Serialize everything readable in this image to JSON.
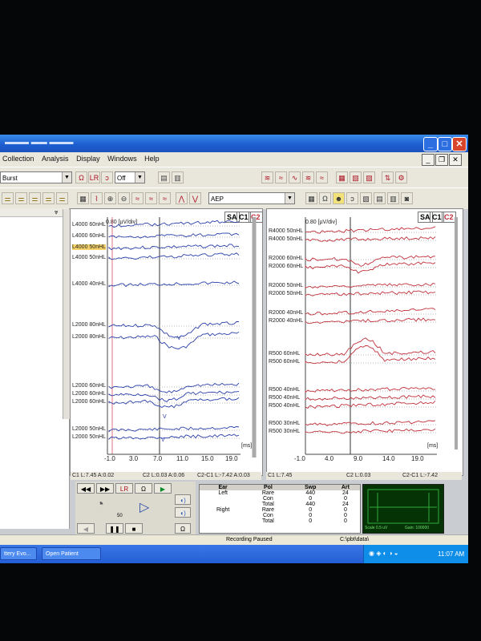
{
  "menu": {
    "items": [
      "Collection",
      "Analysis",
      "Display",
      "Windows",
      "Help"
    ]
  },
  "toolbar": {
    "stimulus_value": "Burst",
    "off_value": "Off",
    "protocol_value": "AEP"
  },
  "left_graph": {
    "scale": "0.80 [µV/div]",
    "toggles": [
      "SA",
      "C1",
      "C2"
    ],
    "channels": [
      "L4000 60nHL",
      "L4000 60nHL",
      "L4000 50nHL",
      "L4000 50nHL",
      "L4000 40nHL",
      "L2000 80nHL",
      "L2000 80nHL",
      "L2000 60nHL",
      "L2000 60nHL",
      "L2000 60nHL",
      "L2000 50nHL",
      "L2000 50nHL"
    ],
    "highlighted_channel": "L4000 50nHL",
    "x_ticks": [
      "-1.0",
      "3.0",
      "7.0",
      "11.0",
      "15.0",
      "19.0"
    ],
    "x_unit": "[ms]",
    "peak_marks": [
      "V",
      "V",
      "V"
    ],
    "status": [
      "C1 L:7.45 A:0.02",
      "C2 L:0.03 A:0.06",
      "C2-C1 L:-7.42 A:0.03"
    ]
  },
  "right_graph": {
    "scale": "0.80 [µV/div]",
    "toggles": [
      "SA",
      "C1",
      "C2"
    ],
    "channels": [
      "R4000 50nHL",
      "R4000 50nHL",
      "R2000 60nHL",
      "R2000 60nHL",
      "R2000 50nHL",
      "R2000 50nHL",
      "R2000 40nHL",
      "R2000 40nHL",
      "R500 60nHL",
      "R500 60nHL",
      "R500 40nHL",
      "R500 40nHL",
      "R500 40nHL",
      "R500 30nHL",
      "R500 30nHL"
    ],
    "x_ticks": [
      "-1.0",
      "4.0",
      "9.0",
      "14.0",
      "19.0"
    ],
    "x_unit": "[ms]",
    "status": [
      "C1 L:7.45",
      "C2 L:0.03",
      "C2-C1 L:-7.42"
    ]
  },
  "controls": {
    "volume_value": "50"
  },
  "sweep_table": {
    "headers": [
      "Ear",
      "Pol",
      "Swp",
      "Art"
    ],
    "rows": [
      [
        "Left",
        "Rare",
        "440",
        "24"
      ],
      [
        "",
        "Con",
        "0",
        "0"
      ],
      [
        "",
        "Total",
        "440",
        "24"
      ],
      [
        "Right",
        "Rare",
        "0",
        "0"
      ],
      [
        "",
        "Con",
        "0",
        "0"
      ],
      [
        "",
        "Total",
        "0",
        "0"
      ]
    ]
  },
  "meter": {
    "scale_label": "Scale 0.5 uV",
    "gain_label": "Gain: 100000"
  },
  "status_bar": {
    "recording": "Recording Paused",
    "path": "C:\\pbt\\data\\"
  },
  "taskbar": {
    "items": [
      "ttery Evo...",
      "Open Patient"
    ],
    "clock": "11:07 AM"
  },
  "colors": {
    "left_trace": "#2a3fa8",
    "right_trace": "#c0303a",
    "xp_blue": "#245ed6",
    "highlight": "#f5d36a"
  }
}
